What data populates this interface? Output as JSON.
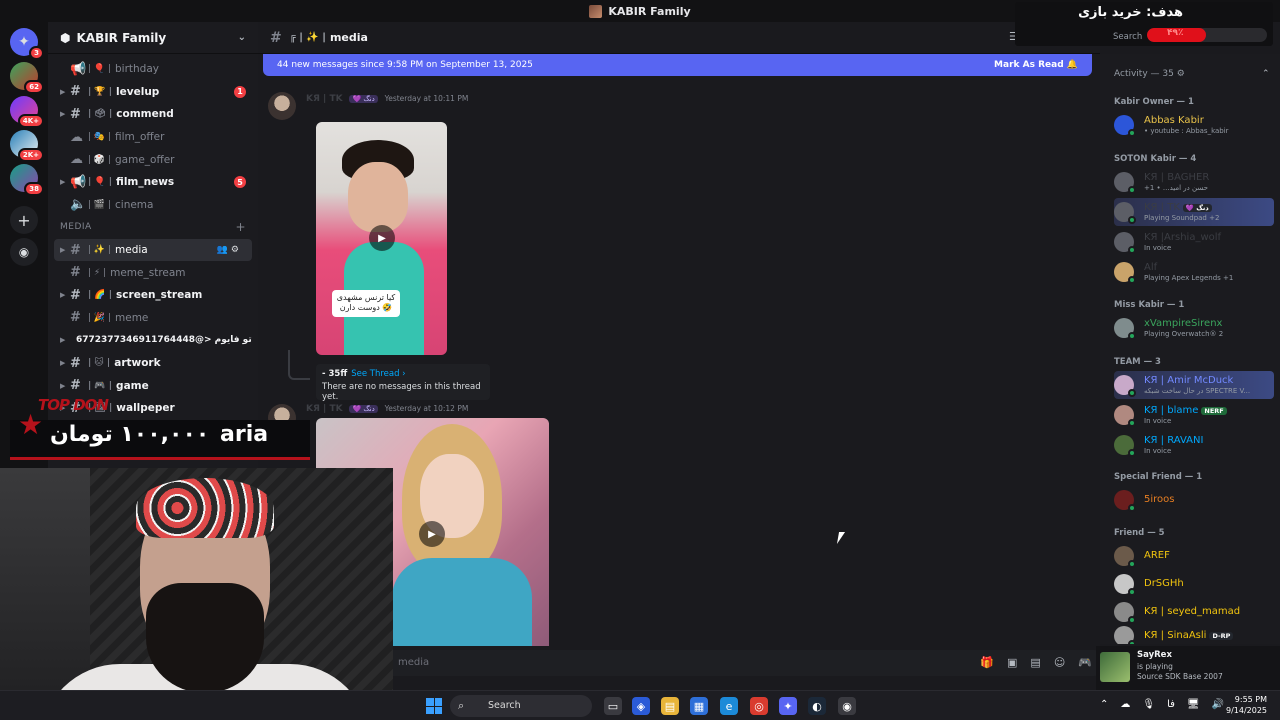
{
  "window": {
    "title": "KABIR Family",
    "minimize": "—",
    "maximize": "☐",
    "close": "✕"
  },
  "rail": {
    "items": [
      {
        "icon": "discord-icon",
        "badge": "3"
      },
      {
        "icon": "server-icon",
        "badge": "62"
      },
      {
        "icon": "server-icon",
        "badge": "4K+"
      },
      {
        "icon": "server-icon",
        "badge": "2K+"
      },
      {
        "icon": "server-icon",
        "badge": "38"
      },
      {
        "icon": "add-server-icon",
        "badge": ""
      },
      {
        "icon": "discover-icon",
        "badge": ""
      }
    ]
  },
  "server": {
    "name": "KABIR Family"
  },
  "channels": [
    {
      "name": "birthday",
      "emoji": "| 🎈 |",
      "unread": false,
      "badge": ""
    },
    {
      "name": "levelup",
      "emoji": "| 🏆 |",
      "unread": true,
      "badge": "1"
    },
    {
      "name": "commend",
      "emoji": "| 🗳 |",
      "unread": true,
      "badge": ""
    },
    {
      "name": "film_offer",
      "emoji": "| 🎭 |",
      "unread": false,
      "badge": ""
    },
    {
      "name": "game_offer",
      "emoji": "| 🎲 |",
      "unread": false,
      "badge": ""
    },
    {
      "name": "film_news",
      "emoji": "| 🎈 |",
      "unread": true,
      "badge": "5"
    },
    {
      "name": "cinema",
      "emoji": "| 🎬 |",
      "unread": false,
      "badge": ""
    },
    {
      "name": "MEDIA",
      "category": true
    },
    {
      "name": "media",
      "emoji": "| ✨ |",
      "active": true
    },
    {
      "name": "meme_stream",
      "emoji": "| ⚡ |",
      "unread": false
    },
    {
      "name": "screen_stream",
      "emoji": "| 🌈 |",
      "unread": true
    },
    {
      "name": "meme",
      "emoji": "| 🎉 |",
      "unread": false
    },
    {
      "name": "6772377346911764448@> عباس تو فایوم",
      "emoji": "",
      "unread": true
    },
    {
      "name": "artwork",
      "emoji": "| 🐱 |",
      "unread": true
    },
    {
      "name": "game",
      "emoji": "| 🎮 |",
      "unread": true
    },
    {
      "name": "wallpeper",
      "emoji": "| 🖼 |",
      "unread": true
    }
  ],
  "chat": {
    "channel": "media",
    "channel_prefix": "╔ | ✨ |",
    "new_messages": "44 new messages since 9:58 PM on September 13, 2025",
    "mark_as_read": "Mark As Read",
    "messages": [
      {
        "author": "KЯ | TK",
        "tag": "💜 دنگ",
        "time": "Yesterday at 10:11 PM",
        "caption": "کیا ترنس مشهدی دوست دارن 🤣"
      },
      {
        "author": "KЯ | TK",
        "tag": "💜 دنگ",
        "time": "Yesterday at 10:12 PM"
      }
    ],
    "thread": {
      "name": "- 35ff",
      "see_thread": "See Thread ›",
      "empty": "There are no messages in this thread yet."
    },
    "composer_placeholder": "media"
  },
  "members": {
    "activity": "Activity — 35",
    "groups": [
      {
        "title": "Kabir Owner — 1",
        "members": [
          {
            "name": "Abbas Kabir",
            "status": "• youtube : Abbas_kabir",
            "color": "#e8c24a"
          }
        ]
      },
      {
        "title": "SOTON Kabir — 4",
        "members": [
          {
            "name": "KЯ | BAGHER",
            "status": "+1 • ...حسن در امید",
            "color": "#3b3d43"
          },
          {
            "name": "KЯ | TK",
            "tag": "💜 دنگ",
            "status": "Playing Soundpad +2",
            "color": "#3b3d43",
            "highlight": true
          },
          {
            "name": "KЯ |Arshia_wolf",
            "status": "In voice",
            "color": "#3b3d43"
          },
          {
            "name": "Alf",
            "status": "Playing Apex Legends +1",
            "color": "#3b3d43"
          }
        ]
      },
      {
        "title": "Miss Kabir — 1",
        "members": [
          {
            "name": "xVampireSirenx",
            "status": "Playing Overwatch® 2",
            "color": "#3ba55d"
          }
        ]
      },
      {
        "title": "TEAM — 3",
        "members": [
          {
            "name": "KЯ | Amir McDuck",
            "status": "در حال ساخت شبکه SPECTRE V...",
            "color": "#5865f2",
            "highlight": true
          },
          {
            "name": "KЯ | blame",
            "tag": "NERF",
            "status": "In voice",
            "color": "#00a8fc"
          },
          {
            "name": "KЯ | RAVANI",
            "status": "In voice",
            "color": "#00a8fc"
          }
        ]
      },
      {
        "title": "Special Friend — 1",
        "members": [
          {
            "name": "5iroos",
            "status": "",
            "color": "#e67e22"
          }
        ]
      },
      {
        "title": "Friend — 5",
        "members": [
          {
            "name": "AREF",
            "status": "",
            "color": "#f1c40f"
          },
          {
            "name": "DrSGHh",
            "status": "",
            "color": "#f1c40f"
          },
          {
            "name": "KЯ | seyed_mamad",
            "status": "",
            "color": "#f1c40f"
          },
          {
            "name": "KЯ | SinaAsli",
            "tag": "D-RP",
            "status": "",
            "color": "#f1c40f"
          }
        ]
      }
    ]
  },
  "now_playing": {
    "name": "SayRex",
    "status": "is playing",
    "game": "Source SDK Base 2007"
  },
  "overlay": {
    "goal_title": "هدف: خرید بازی",
    "goal_percent": "۴۹٪",
    "goal_fraction": 0.49,
    "search_placeholder": "Search",
    "donation_brand": "TOP DON",
    "donation_amount": "۱۰۰,۰۰۰ تومان",
    "donation_name": "aria"
  },
  "taskbar": {
    "search": "Search",
    "time": "9:55 PM",
    "date": "9/14/2025",
    "lang": "فا"
  },
  "colors": {
    "accent": "#5865f2",
    "danger": "#f23f43",
    "online": "#23a55a"
  }
}
